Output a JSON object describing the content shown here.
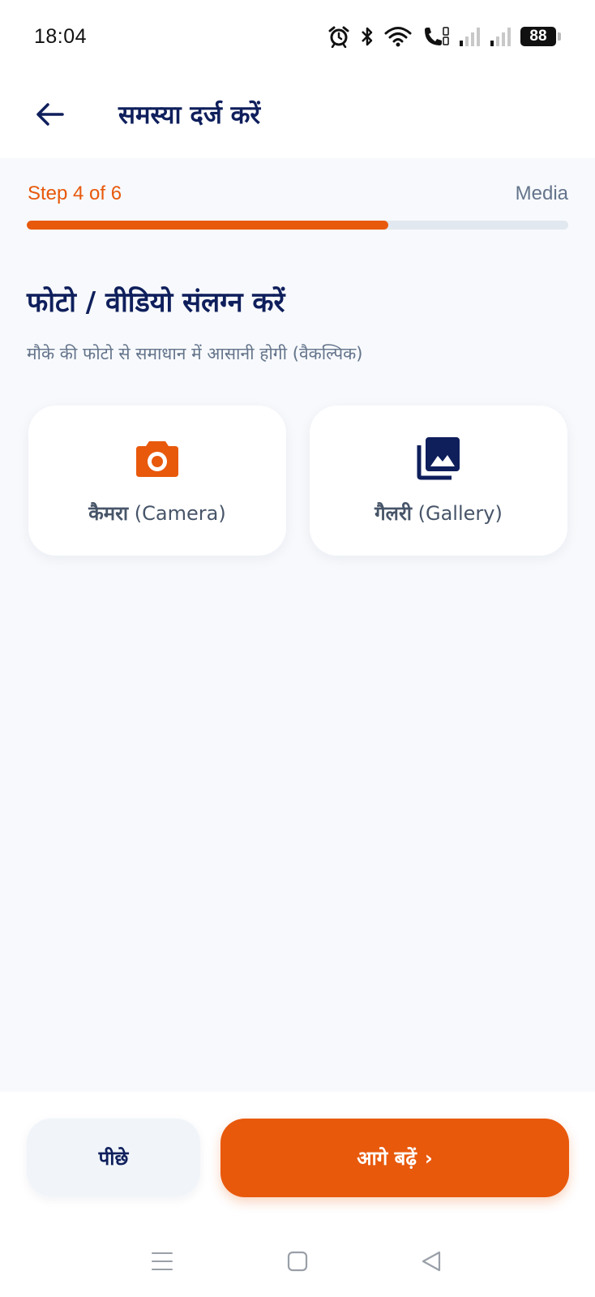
{
  "status_bar": {
    "time": "18:04",
    "battery": "88",
    "icons": [
      "alarm-icon",
      "bluetooth-icon",
      "wifi-icon",
      "wifi-call-icon",
      "signal-icon",
      "signal-icon",
      "battery-icon"
    ]
  },
  "app_bar": {
    "title": "समस्या दर्ज करें",
    "back_icon": "arrow-left-icon"
  },
  "progress": {
    "step_label": "Step 4 of 6",
    "step_name": "Media",
    "fraction": 0.667
  },
  "section": {
    "title": "फोटो / वीडियो संलग्न करें",
    "subtitle": "मौके की फोटो से समाधान में आसानी होगी (वैकल्पिक)"
  },
  "options": {
    "camera": {
      "label_hi": "कैमरा",
      "label_en": "(Camera)",
      "icon": "camera-icon"
    },
    "gallery": {
      "label_hi": "गैलरी",
      "label_en": "(Gallery)",
      "icon": "photo-library-icon"
    }
  },
  "footer": {
    "back_label": "पीछे",
    "next_label": "आगे बढ़ें",
    "next_chevron": "›"
  },
  "colors": {
    "accent": "#e8590c",
    "navy": "#0f1f5c",
    "muted": "#64748b",
    "background": "#f7f9fc"
  }
}
